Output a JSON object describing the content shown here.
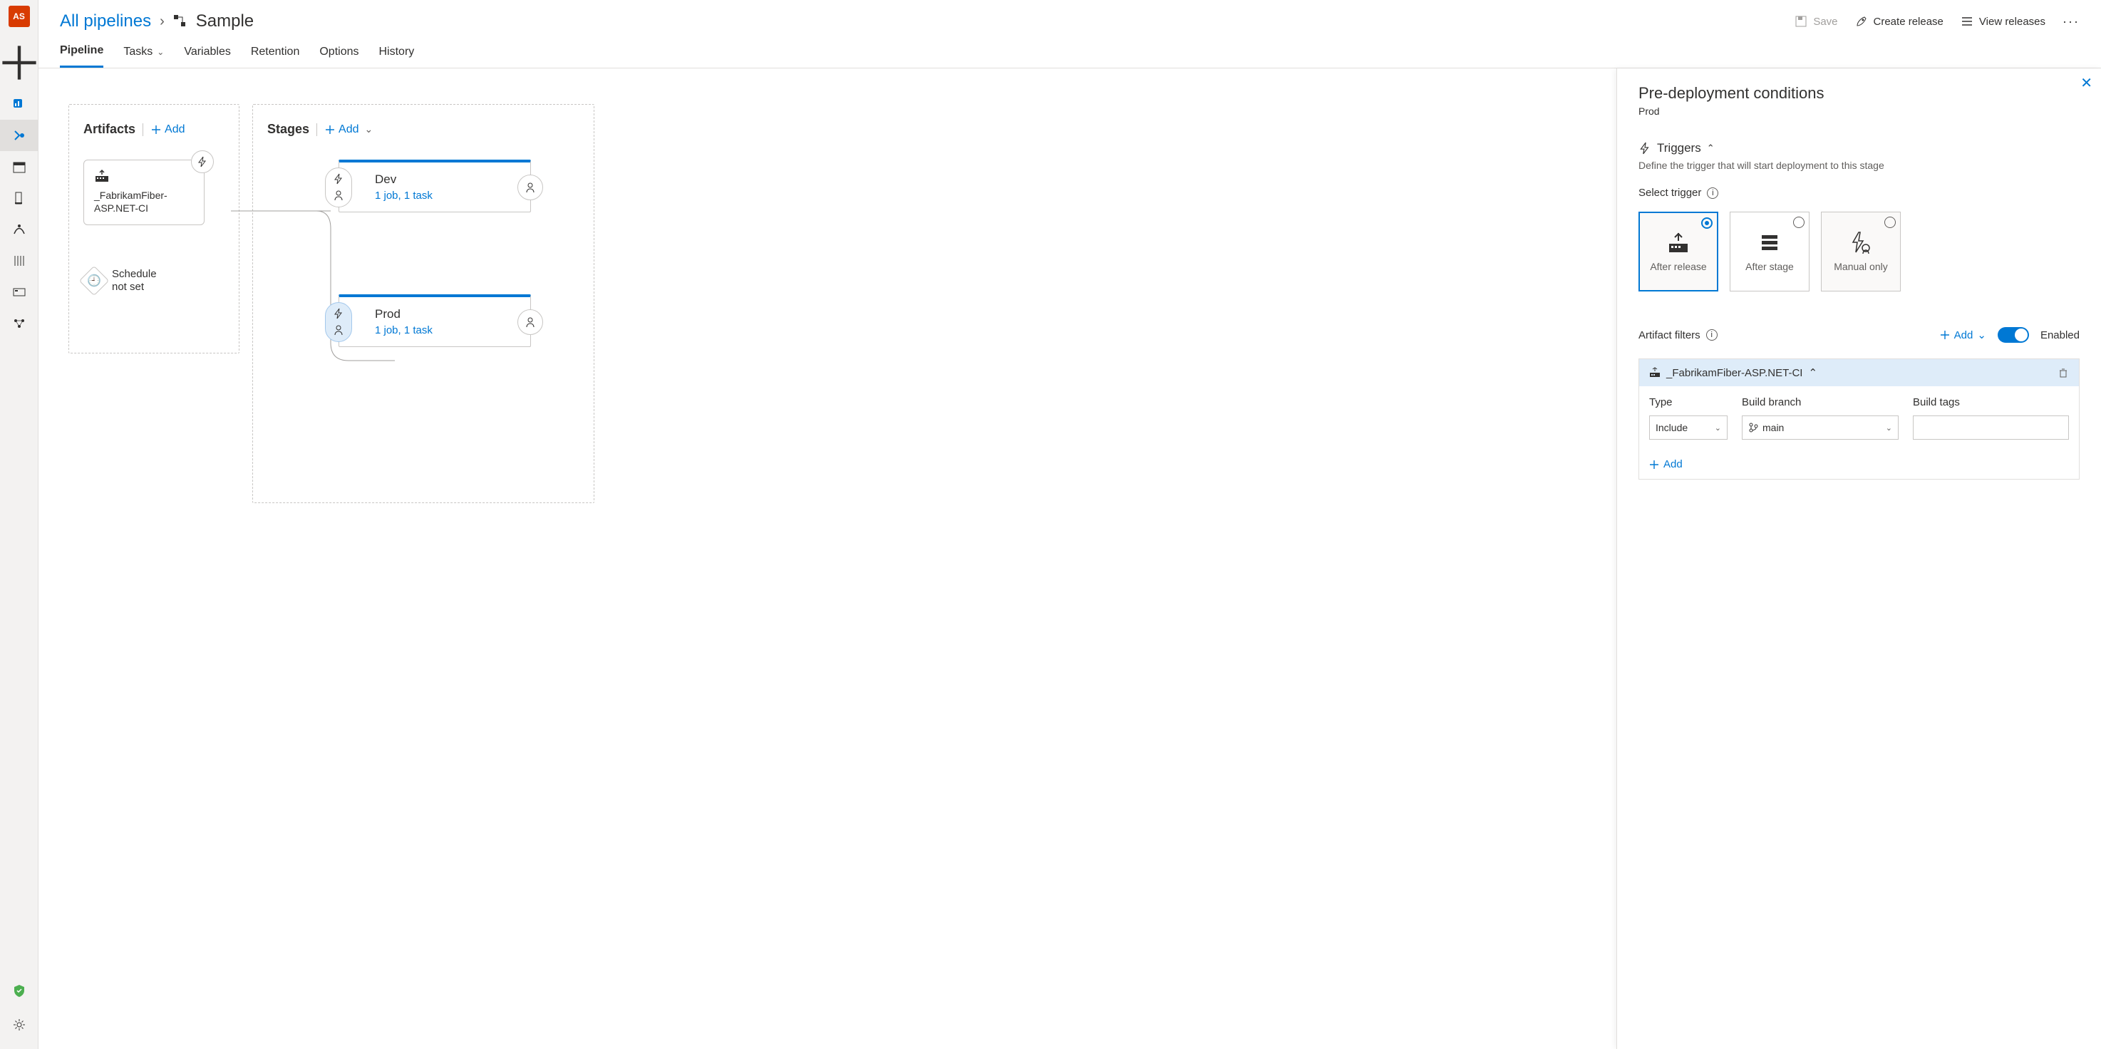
{
  "siderail": {
    "avatar": "AS"
  },
  "breadcrumb": {
    "root": "All pipelines",
    "name": "Sample"
  },
  "toolbar": {
    "save": "Save",
    "create_release": "Create release",
    "view_releases": "View releases"
  },
  "tabs": {
    "pipeline": "Pipeline",
    "tasks": "Tasks",
    "variables": "Variables",
    "retention": "Retention",
    "options": "Options",
    "history": "History"
  },
  "canvas": {
    "artifacts_title": "Artifacts",
    "stages_title": "Stages",
    "add": "Add",
    "artifact_name": "_FabrikamFiber-ASP.NET-CI",
    "schedule_l1": "Schedule",
    "schedule_l2": "not set",
    "stage_dev": {
      "name": "Dev",
      "sub": "1 job, 1 task"
    },
    "stage_prod": {
      "name": "Prod",
      "sub": "1 job, 1 task"
    }
  },
  "panel": {
    "title": "Pre-deployment conditions",
    "stage": "Prod",
    "triggers_label": "Triggers",
    "triggers_desc": "Define the trigger that will start deployment to this stage",
    "select_trigger": "Select trigger",
    "trigger_after_release": "After release",
    "trigger_after_stage": "After stage",
    "trigger_manual": "Manual only",
    "artifact_filters": "Artifact filters",
    "add": "Add",
    "enabled": "Enabled",
    "filter_name": "_FabrikamFiber-ASP.NET-CI",
    "col_type": "Type",
    "col_branch": "Build branch",
    "col_tags": "Build tags",
    "type_value": "Include",
    "branch_value": "main",
    "add_row": "Add"
  }
}
